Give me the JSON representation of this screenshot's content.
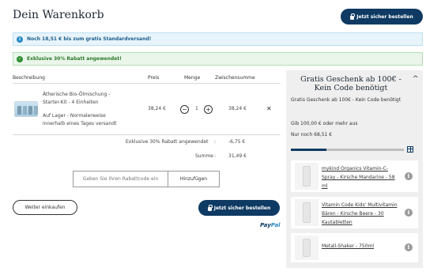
{
  "header": {
    "title": "Dein Warenkorb",
    "checkout_label": "Jetzt sicher bestellen"
  },
  "banners": {
    "info": "Noch 18,51 € bis zum gratis Standardversand!",
    "success": "Exklusive 30% Rabatt angewendet!"
  },
  "table": {
    "headers": {
      "description": "Beschreibung",
      "price": "Preis",
      "quantity": "Menge",
      "subtotal": "Zwischensumme"
    },
    "item": {
      "name_line1": "Ätherische Bio-Ölmischung -",
      "name_line2": "Starter-Kit - 4 Einheiten",
      "stock": "Auf Lager -  Normalerweise",
      "shipping": "innerhalb eines Tages versandt",
      "price": "38,24 €",
      "quantity": "1",
      "subtotal": "38,24 €",
      "minus": "−",
      "plus": "+",
      "remove": "✕"
    },
    "discount_label": "Exklusive 30% Rabatt angewendet",
    "discount_value": "-6,75 €",
    "sum_label": "Summe",
    "sum_value": "31,49 €"
  },
  "coupon": {
    "placeholder": "Geben Sie Ihren Rabattcode ein",
    "button": "Hinzufügen"
  },
  "actions": {
    "continue": "Weiter einkaufen",
    "checkout": "Jetzt sicher bestellen",
    "paypal_a": "Pay",
    "paypal_b": "Pal"
  },
  "sidebar": {
    "title": "Gratis Geschenk ab 100€ - Kein Code benötigt",
    "subtitle": "Gratis Geschenk ab 100€ - Kein Code benötigt",
    "threshold": "Gib 100,00 € oder mehr aus",
    "remaining": "Nur noch 68,51 €",
    "progress": 0.315,
    "gifts": [
      {
        "name": "mykind Organics Vitamin-C-Spray - Kirsche Mandarine - 58 ml"
      },
      {
        "name": "Vitamin Code Kids' Multivitamin Bären - Kirsche Beere - 30 Kautabletten"
      },
      {
        "name": "Metall-Shaker - 750ml"
      }
    ]
  },
  "colors": {
    "primary": "#0e3a63",
    "info_bg": "#e8f4fb",
    "success_bg": "#eaf6ea",
    "sidebar_bg": "#efefef"
  }
}
